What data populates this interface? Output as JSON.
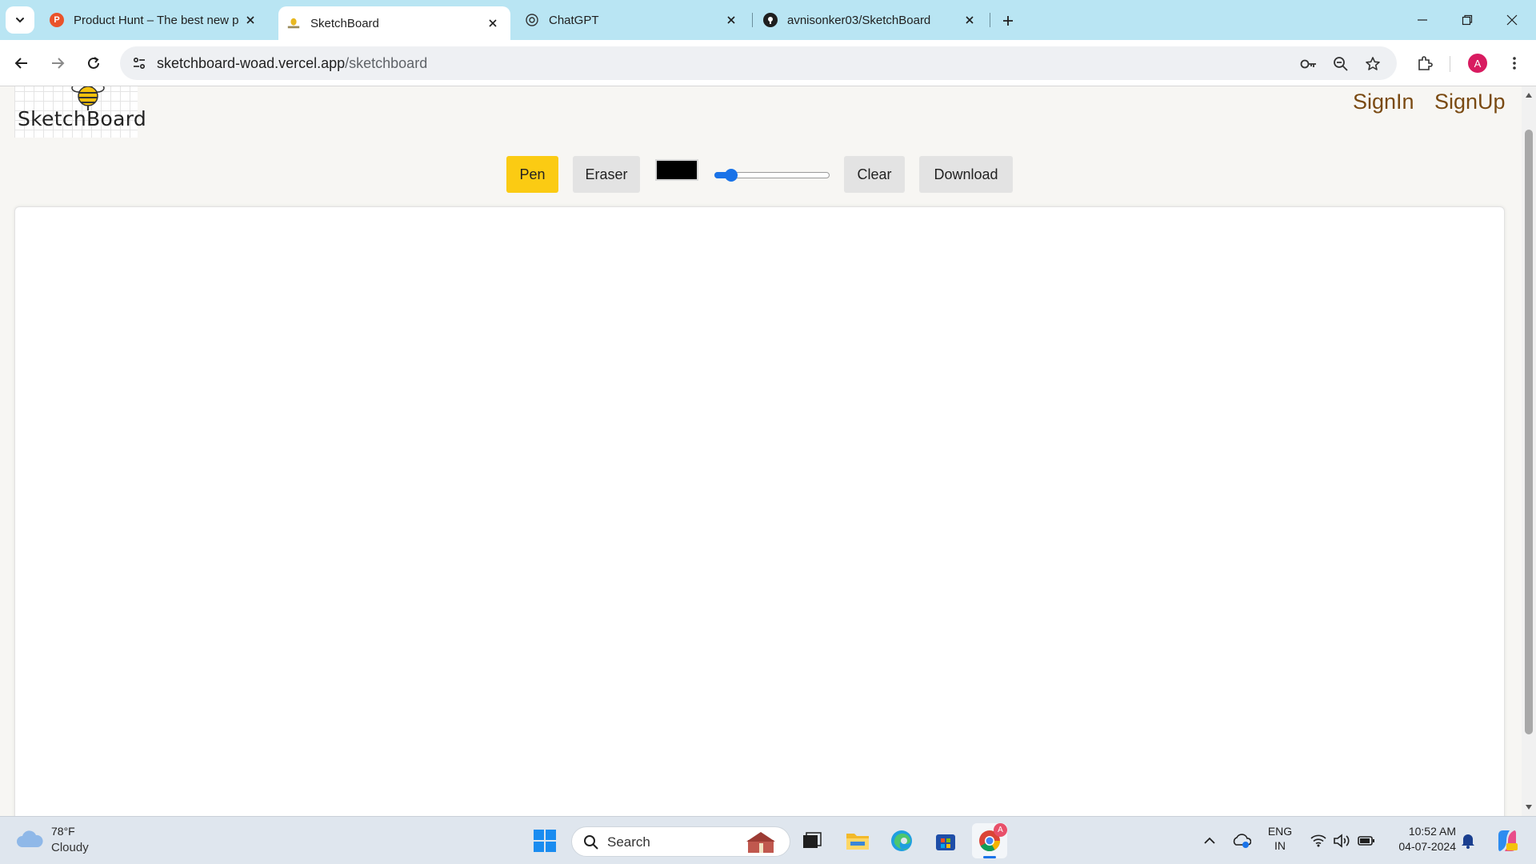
{
  "browser": {
    "tabs": [
      {
        "title": "Product Hunt – The best new p",
        "favicon_letter": "P",
        "active": false
      },
      {
        "title": "SketchBoard",
        "active": true
      },
      {
        "title": "ChatGPT",
        "active": false
      },
      {
        "title": "avnisonker03/SketchBoard",
        "active": false
      }
    ],
    "address": {
      "domain": "sketchboard-woad.vercel.app",
      "path": "/sketchboard"
    },
    "profile_initial": "A"
  },
  "page": {
    "logo_text": "SketchBoard",
    "auth": {
      "signin": "SignIn",
      "signup": "SignUp"
    },
    "toolbar": {
      "pen": "Pen",
      "eraser": "Eraser",
      "color": "#000000",
      "brush_size_fraction": 0.1,
      "clear": "Clear",
      "download": "Download"
    }
  },
  "taskbar": {
    "weather": {
      "temp": "78°F",
      "condition": "Cloudy"
    },
    "search_label": "Search",
    "language": {
      "line1": "ENG",
      "line2": "IN"
    },
    "time": "10:52 AM",
    "date": "04-07-2024",
    "chrome_badge": "A"
  },
  "colors": {
    "tab_strip": "#b9e5f3",
    "pen_button": "#fbcb13",
    "auth_link": "#7a4a12",
    "slider_accent": "#1a73e8"
  }
}
